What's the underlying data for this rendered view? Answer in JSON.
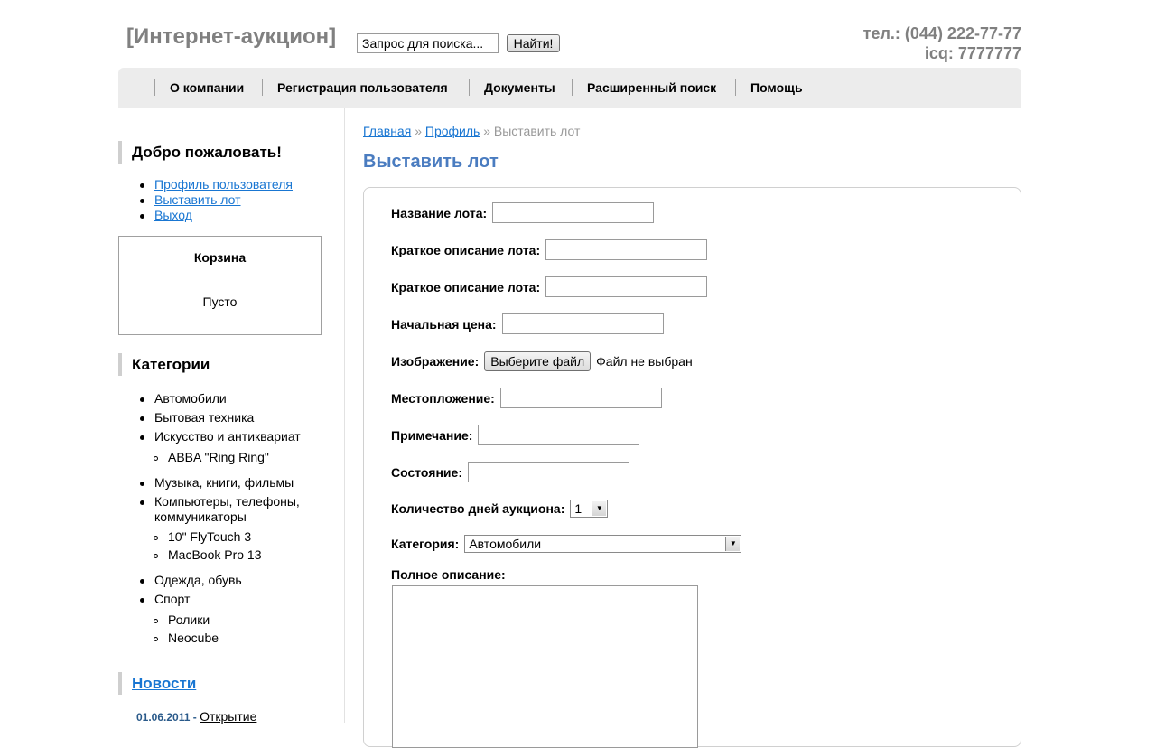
{
  "header": {
    "logo": "[Интернет-аукцион]",
    "search": {
      "placeholder": "Запрос для поиска...",
      "value": "Запрос для поиска..."
    },
    "search_button": "Найти!",
    "phone": "тел.: (044) 222-77-77",
    "icq": "icq: 7777777"
  },
  "nav": {
    "items": [
      {
        "label": "О компании"
      },
      {
        "label": "Регистрация пользователя"
      },
      {
        "label": "Документы"
      },
      {
        "label": "Расширенный поиск"
      },
      {
        "label": "Помощь"
      }
    ]
  },
  "sidebar": {
    "welcome": {
      "title": "Добро пожаловать!",
      "links": [
        "Профиль пользователя",
        "Выставить лот",
        "Выход"
      ]
    },
    "cart": {
      "title": "Корзина",
      "status": "Пусто"
    },
    "categories": {
      "title": "Категории",
      "items": [
        "Автомобили",
        "Бытовая техника",
        "Искусство и антиквариат",
        "ABBA \"Ring Ring\"",
        "Музыка, книги, фильмы",
        "Компьютеры, телефоны, коммуникаторы",
        "10\" FlyTouch 3",
        "MacBook Pro 13",
        "Одежда, обувь",
        "Спорт",
        "Ролики",
        "Neocube"
      ]
    },
    "news": {
      "title": "Новости",
      "items": [
        {
          "date": "01.06.2011",
          "separator": "-",
          "title": "Открытие"
        }
      ]
    }
  },
  "main": {
    "breadcrumb": {
      "home": "Главная",
      "sep": "»",
      "profile": "Профиль",
      "current": "Выставить лот"
    },
    "title": "Выставить лот",
    "form": {
      "name": {
        "label": "Название лота:",
        "value": ""
      },
      "short_desc_1": {
        "label": "Краткое описание лота:",
        "value": ""
      },
      "short_desc_2": {
        "label": "Краткое описание лота:",
        "value": ""
      },
      "start_price": {
        "label": "Начальная цена:",
        "value": ""
      },
      "image": {
        "label": "Изображение:",
        "button": "Выберите файл",
        "status": "Файл не выбран"
      },
      "location": {
        "label": "Местопложение:",
        "value": ""
      },
      "note": {
        "label": "Примечание:",
        "value": ""
      },
      "condition": {
        "label": "Состояние:",
        "value": ""
      },
      "days": {
        "label": "Количество дней аукциона:",
        "value": "1"
      },
      "category": {
        "label": "Категория:",
        "value": "Автомобили"
      },
      "full_desc": {
        "label": "Полное описание:",
        "value": ""
      }
    }
  }
}
